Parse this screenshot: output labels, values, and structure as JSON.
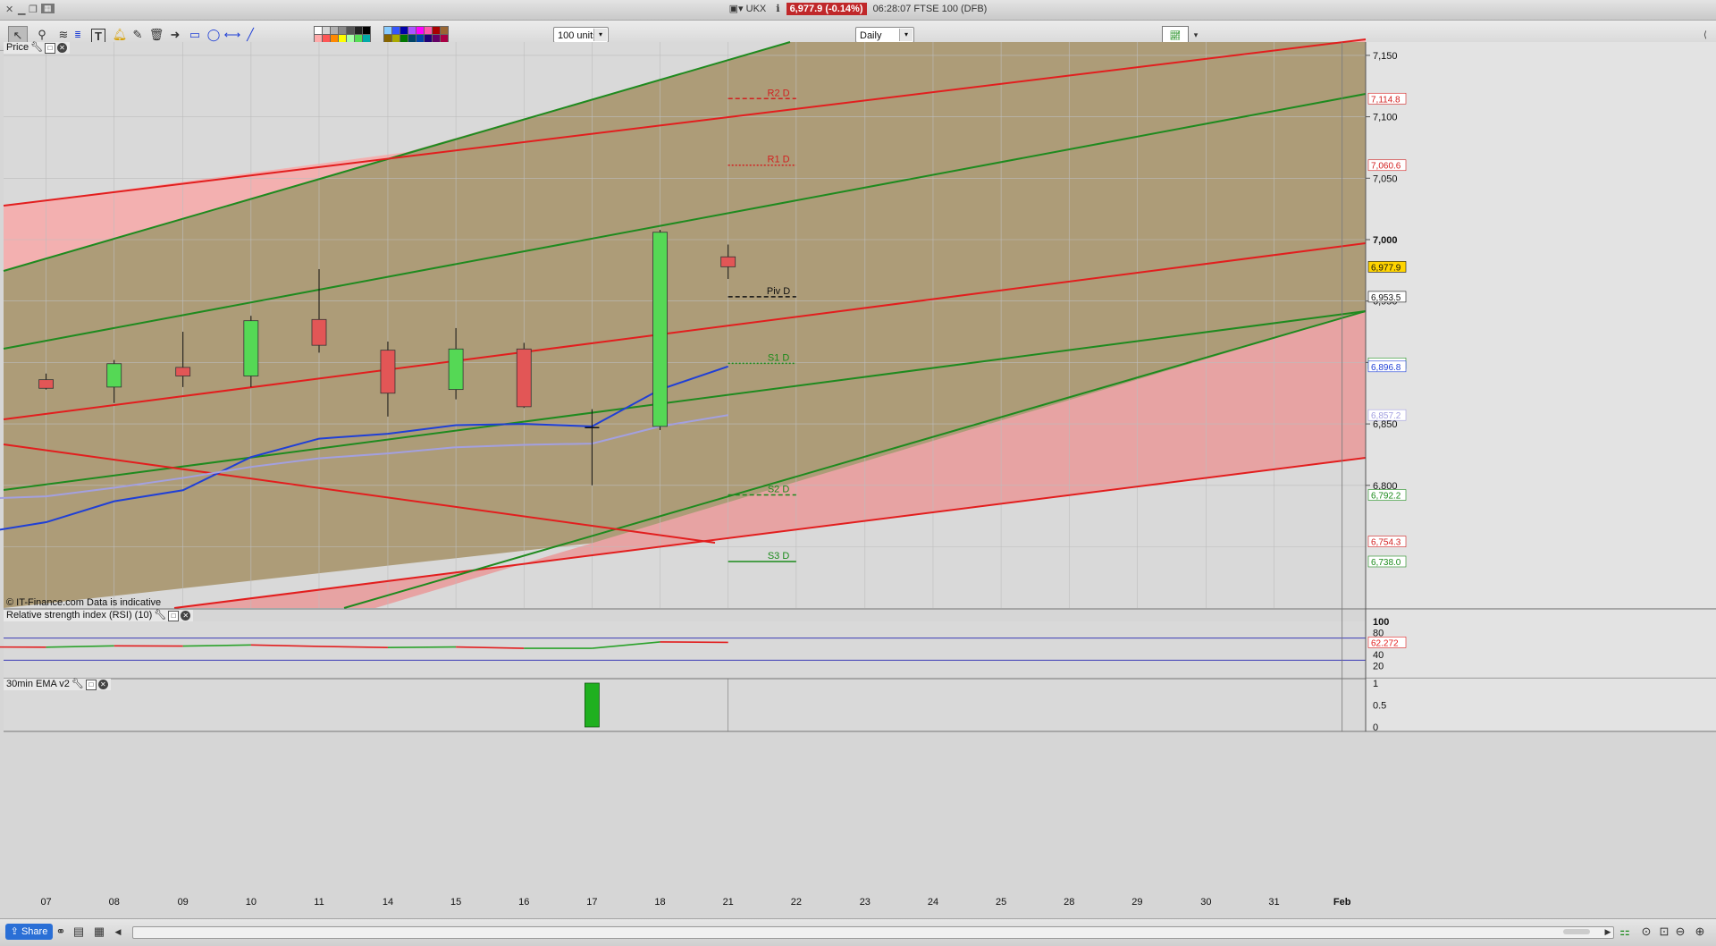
{
  "titlebar": {
    "symbol": "UKX",
    "price_badge": "6,977.9 (-0.14%)",
    "info": "06:28:07 FTSE 100 (DFB)"
  },
  "toolbar": {
    "units_select": "100 units",
    "period_select": "Daily"
  },
  "price_panel": {
    "label": "Price",
    "copyright": "© IT-Finance.com  Data is indicative"
  },
  "rsi_panel": {
    "label": "Relative strength index (RSI) (10)",
    "axis": [
      "100",
      "80",
      "60",
      "40",
      "20"
    ],
    "value_tag": "62.272"
  },
  "ema_panel": {
    "label": "30min EMA v2",
    "axis": [
      "1",
      "0.5",
      "0"
    ]
  },
  "bottombar": {
    "share_label": "Share"
  },
  "chart_data": {
    "type": "candlestick",
    "x_labels": [
      "07",
      "08",
      "09",
      "10",
      "11",
      "14",
      "15",
      "16",
      "17",
      "18",
      "21",
      "22",
      "23",
      "24",
      "25",
      "28",
      "29",
      "30",
      "31",
      "Feb"
    ],
    "y_axis_ticks": [
      "7,150",
      "7,100",
      "7,050",
      "7,000",
      "6,950",
      "6,900",
      "6,850",
      "6,800"
    ],
    "ylim": [
      6700,
      7162
    ],
    "candles": [
      {
        "x": "07",
        "open": 6886,
        "high": 6891,
        "low": 6878,
        "close": 6879
      },
      {
        "x": "08",
        "open": 6880,
        "high": 6902,
        "low": 6867,
        "close": 6899
      },
      {
        "x": "09",
        "open": 6896,
        "high": 6925,
        "low": 6880,
        "close": 6889
      },
      {
        "x": "10",
        "open": 6889,
        "high": 6938,
        "low": 6880,
        "close": 6934
      },
      {
        "x": "11",
        "open": 6935,
        "high": 6976,
        "low": 6908,
        "close": 6914
      },
      {
        "x": "14",
        "open": 6910,
        "high": 6917,
        "low": 6856,
        "close": 6875
      },
      {
        "x": "15",
        "open": 6878,
        "high": 6928,
        "low": 6870,
        "close": 6911
      },
      {
        "x": "16",
        "open": 6911,
        "high": 6916,
        "low": 6863,
        "close": 6864
      },
      {
        "x": "17",
        "open": 6847,
        "high": 6862,
        "low": 6800,
        "close": 6847
      },
      {
        "x": "18",
        "open": 6848,
        "high": 7008,
        "low": 6845,
        "close": 7006
      },
      {
        "x": "21",
        "open": 6986,
        "high": 6996,
        "low": 6968,
        "close": 6977.9
      }
    ],
    "moving_averages": [
      {
        "color": "#1f3fd6",
        "points": [
          [
            -1,
            6761
          ],
          [
            "07",
            6770
          ],
          [
            "08",
            6787
          ],
          [
            "09",
            6796
          ],
          [
            "10",
            6823
          ],
          [
            "11",
            6838
          ],
          [
            "14",
            6842
          ],
          [
            "15",
            6849
          ],
          [
            "16",
            6850
          ],
          [
            "17",
            6848
          ],
          [
            "18",
            6878
          ],
          [
            "21",
            6896.8
          ]
        ]
      },
      {
        "color": "#a3a0e0",
        "points": [
          [
            -1,
            6789
          ],
          [
            "07",
            6791
          ],
          [
            "08",
            6798
          ],
          [
            "09",
            6806
          ],
          [
            "10",
            6815
          ],
          [
            "11",
            6822
          ],
          [
            "14",
            6826
          ],
          [
            "15",
            6831
          ],
          [
            "16",
            6833
          ],
          [
            "17",
            6834
          ],
          [
            "18",
            6848
          ],
          [
            "21",
            6857.2
          ]
        ]
      }
    ],
    "pivots": [
      {
        "label": "R2 D",
        "value": 7114.8,
        "color": "#d22020",
        "style": "dashed"
      },
      {
        "label": "R1 D",
        "value": 7060.6,
        "color": "#d22020",
        "style": "dotted"
      },
      {
        "label": "Piv D",
        "value": 6953.5,
        "color": "#111111",
        "style": "dashed"
      },
      {
        "label": "S1 D",
        "value": 6899.3,
        "color": "#1a8a1a",
        "style": "dotted"
      },
      {
        "label": "S2 D",
        "value": 6792.2,
        "color": "#1a8a1a",
        "style": "dashed"
      },
      {
        "label": "S3 D",
        "value": 6738.0,
        "color": "#1a8a1a",
        "style": "solid"
      }
    ],
    "price_tags": [
      {
        "value": "7,114.8",
        "bg": "#ffffff",
        "fg": "#d22020"
      },
      {
        "value": "7,060.6",
        "bg": "#ffffff",
        "fg": "#d22020"
      },
      {
        "value": "6,977.9",
        "bg": "#ffd400",
        "fg": "#111111"
      },
      {
        "value": "6,953.5",
        "bg": "#ffffff",
        "fg": "#111111"
      },
      {
        "value": "6,899.3",
        "bg": "#ffffff",
        "fg": "#1a8a1a"
      },
      {
        "value": "6,896.8",
        "bg": "#ffffff",
        "fg": "#1f3fd6"
      },
      {
        "value": "6,857.2",
        "bg": "#ffffff",
        "fg": "#a3a0e0"
      },
      {
        "value": "6,792.2",
        "bg": "#ffffff",
        "fg": "#1a8a1a"
      },
      {
        "value": "6,754.3",
        "bg": "#ffffff",
        "fg": "#d22020"
      },
      {
        "value": "6,738.0",
        "bg": "#ffffff",
        "fg": "#1a8a1a"
      }
    ],
    "rsi": {
      "levels": [
        70,
        30
      ],
      "values": [
        {
          "x": -1,
          "v": 54
        },
        {
          "x": "07",
          "v": 53.5
        },
        {
          "x": "08",
          "v": 56
        },
        {
          "x": "09",
          "v": 55.5
        },
        {
          "x": "10",
          "v": 57.5
        },
        {
          "x": "11",
          "v": 55
        },
        {
          "x": "14",
          "v": 53
        },
        {
          "x": "15",
          "v": 54
        },
        {
          "x": "16",
          "v": 51.5
        },
        {
          "x": "17",
          "v": 51.5
        },
        {
          "x": "18",
          "v": 63
        },
        {
          "x": "21",
          "v": 62.272
        }
      ]
    },
    "ema_signal": [
      {
        "x": "17",
        "v": 1
      }
    ],
    "colors": {
      "bull": "#55d855",
      "bear": "#e25656",
      "channel_fill": "#ad9c78",
      "upper_green": "#aed3a9",
      "upper_red": "#f3b0b0",
      "lower_red": "#e7a3a3"
    }
  }
}
